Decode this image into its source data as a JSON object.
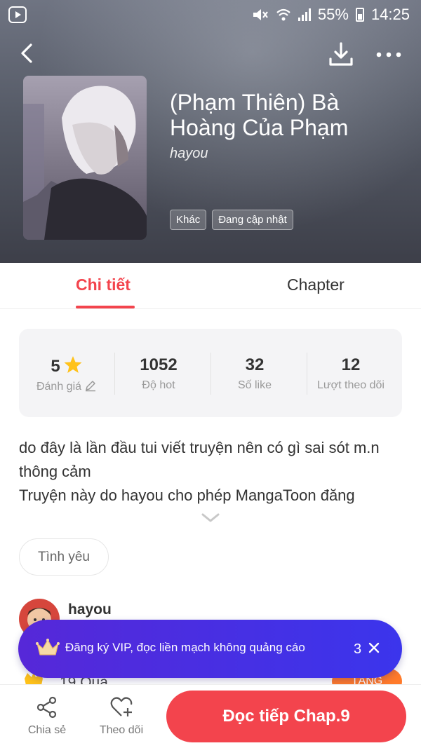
{
  "status_bar": {
    "battery": "55%",
    "time": "14:25"
  },
  "book": {
    "title": "(Phạm Thiên) Bà Hoàng Của Phạm",
    "author": "hayou",
    "tags": [
      "Khác",
      "Đang cập nhật"
    ]
  },
  "tabs": [
    {
      "label": "Chi tiết",
      "active": true
    },
    {
      "label": "Chapter",
      "active": false
    }
  ],
  "stats": [
    {
      "value": "5",
      "label": "Đánh giá"
    },
    {
      "value": "1052",
      "label": "Độ hot"
    },
    {
      "value": "32",
      "label": "Số like"
    },
    {
      "value": "12",
      "label": "Lượt theo dõi"
    }
  ],
  "description": {
    "lines": [
      "do đây là lần đầu tui viết truyện nên có gì sai sót m.n",
      "thông cảm",
      "Truyện này do hayou cho phép MangaToon đăng"
    ]
  },
  "genre": "Tình yêu",
  "author_section": {
    "name": "hayou"
  },
  "gift_row": {
    "text": "19 Quà",
    "button": "TẶNG"
  },
  "vip_banner": {
    "text": "Đăng ký VIP, đọc liền mạch không quảng cáo",
    "countdown": "3"
  },
  "bottom_bar": {
    "share_label": "Chia sẻ",
    "follow_label": "Theo dõi",
    "read_button": "Đọc tiếp Chap.9"
  },
  "colors": {
    "accent": "#f3444d",
    "vip": "#4a2fe0",
    "gift": "#ff7a2a",
    "star": "#ffc21a"
  }
}
